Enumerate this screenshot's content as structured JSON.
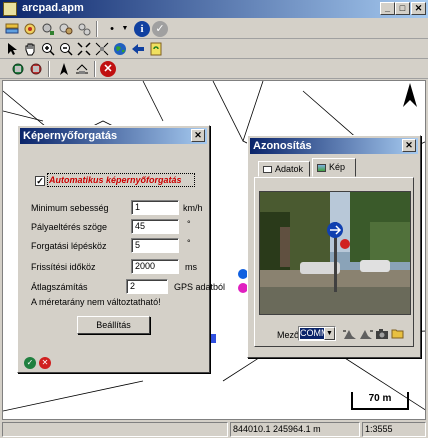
{
  "app": {
    "title": "arcpad.apm"
  },
  "window_controls": {
    "minimize": "_",
    "maximize": "□",
    "close": "✕"
  },
  "capture_dialog": {
    "title": "Képernyőforgatás",
    "auto_checkbox_label": "Automatikus képernyőforgatás",
    "auto_checked": true,
    "fields": [
      {
        "label": "Minimum sebesség",
        "value": "1",
        "unit": "km/h"
      },
      {
        "label": "Pályaeltérés szöge",
        "value": "45",
        "unit": "°"
      },
      {
        "label": "Forgatási lépésköz",
        "value": "5",
        "unit": "°"
      },
      {
        "label": "Frissítési időköz",
        "value": "2000",
        "unit": "ms"
      }
    ],
    "avg_label": "Átlagszámítás",
    "avg_value": "2",
    "avg_suffix": "GPS adatból",
    "scale_note": "A méretarány nem változtatható!",
    "settings_button": "Beállítás"
  },
  "identify_dialog": {
    "title": "Azonosítás",
    "tabs": [
      {
        "label": "Adatok"
      },
      {
        "label": "Kép"
      }
    ],
    "active_tab": "Kép",
    "field_label": "Mező",
    "field_value": "COMM",
    "photo_scene": "ROW 1:▯▯▯▯▯▯▯▯▯▯▯▯▯▯▯▯"
  },
  "map": {
    "scale_bar": "70 m",
    "north": "N"
  },
  "status": {
    "coordinates": "844010.1 245964.1 m",
    "scale": "1:3555"
  },
  "colors": {
    "title_start": "#0a246a",
    "title_end": "#a6caf0",
    "checkbox_text": "#cc0000"
  }
}
